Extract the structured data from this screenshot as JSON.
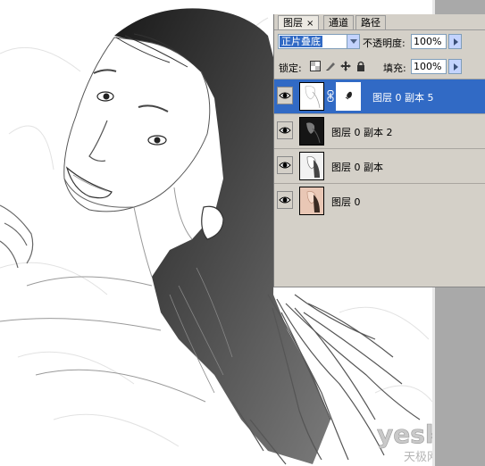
{
  "panel": {
    "tabs": [
      {
        "label": "图层",
        "close": "×",
        "active": true
      },
      {
        "label": "通道",
        "active": false
      },
      {
        "label": "路径",
        "active": false
      }
    ],
    "blend_mode": "正片叠底",
    "opacity_label": "不透明度:",
    "opacity_value": "100%",
    "lock_label": "锁定:",
    "fill_label": "填充:",
    "fill_value": "100%",
    "layers": [
      {
        "name": "图层 0 副本 5",
        "selected": true,
        "has_mask": true
      },
      {
        "name": "图层 0 副本 2",
        "selected": false,
        "has_mask": false
      },
      {
        "name": "图层 0 副本",
        "selected": false,
        "has_mask": false
      },
      {
        "name": "图层 0",
        "selected": false,
        "has_mask": false
      }
    ]
  },
  "watermark": {
    "brand": "yesky",
    "chinese": "天极网"
  },
  "colors": {
    "selection": "#316ac5",
    "panel_bg": "#d4d0c8"
  }
}
